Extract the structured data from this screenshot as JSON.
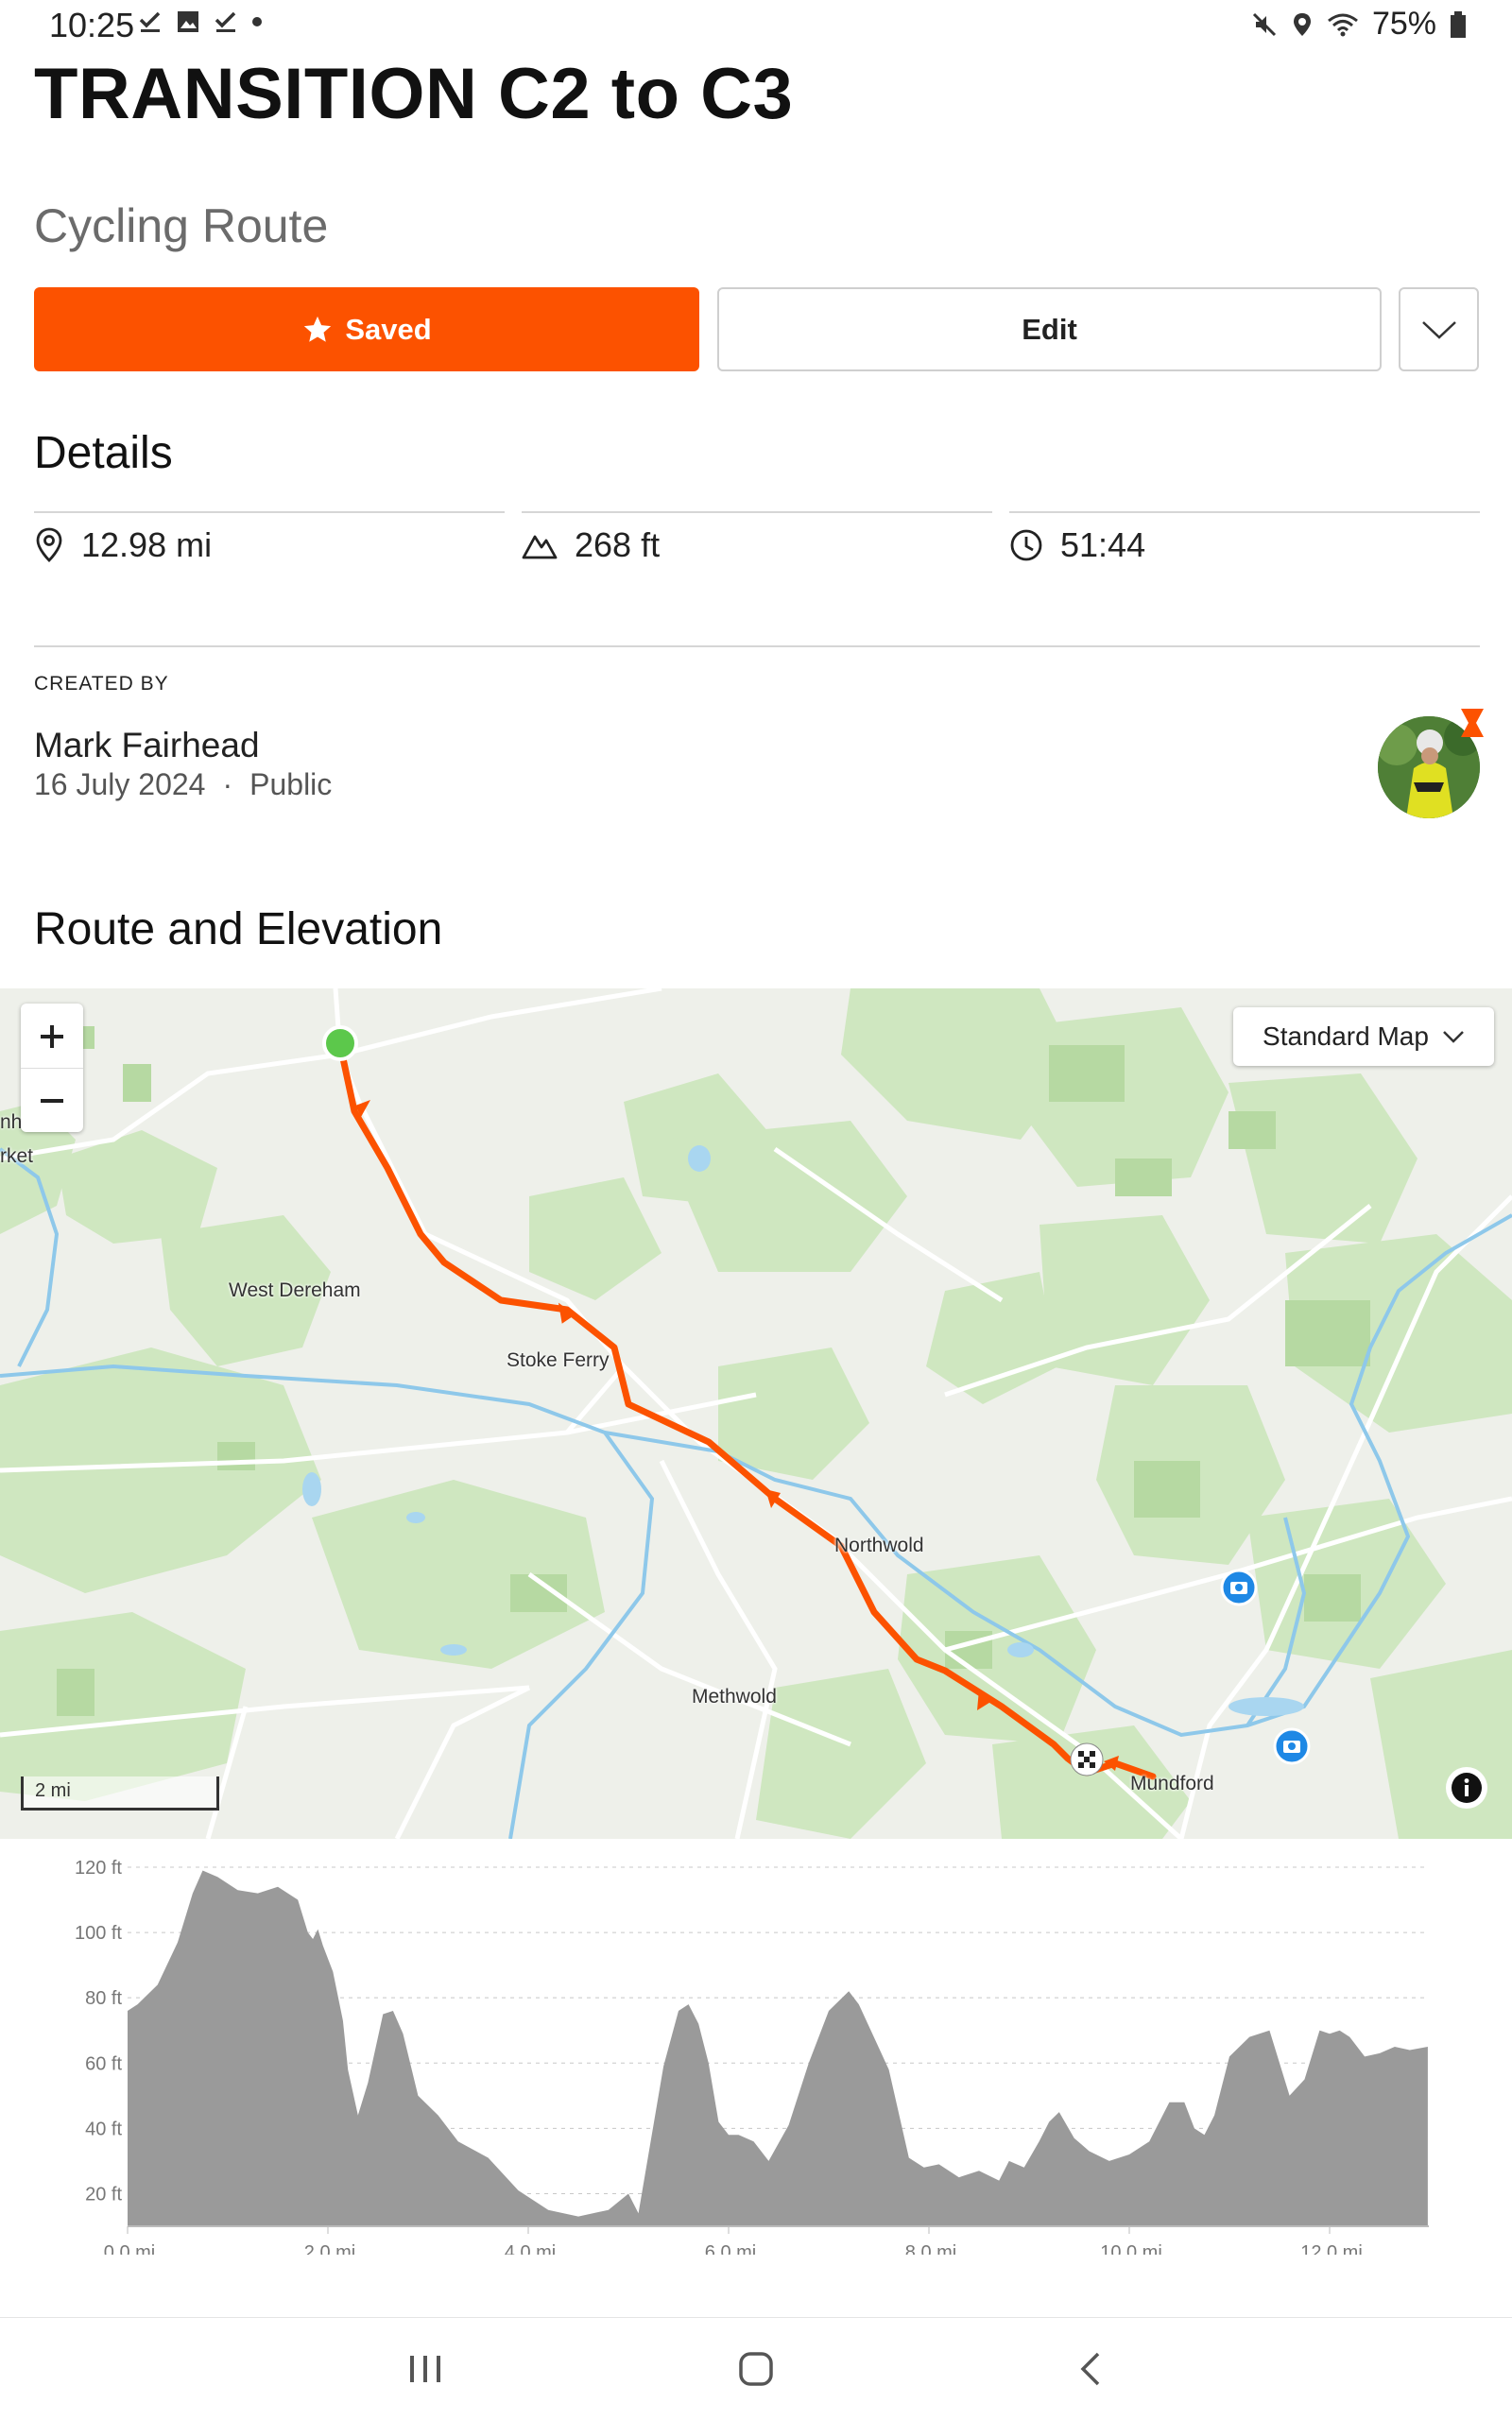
{
  "status_bar": {
    "time": "10:25",
    "battery": "75%"
  },
  "route": {
    "title": "TRANSITION C2 to C3",
    "type": "Cycling Route",
    "saved_label": "Saved",
    "edit_label": "Edit"
  },
  "details": {
    "heading": "Details",
    "distance": "12.98 mi",
    "elevation_gain": "268 ft",
    "est_time": "51:44"
  },
  "creator": {
    "label": "CREATED BY",
    "name": "Mark Fairhead",
    "date": "16 July 2024",
    "separator": "·",
    "visibility": "Public"
  },
  "map_section": {
    "heading": "Route and Elevation",
    "map_type": "Standard Map",
    "scale": "2 mi",
    "places": [
      "nham",
      "rket",
      "West Dereham",
      "Stoke Ferry",
      "Northwold",
      "Methwold",
      "Mundford"
    ]
  },
  "colors": {
    "accent": "#fc5200",
    "start": "#5cc84b",
    "elevation_fill": "#9a9a9a"
  },
  "chart_data": {
    "type": "area",
    "x_ticks": [
      "0.0 mi",
      "2.0 mi",
      "4.0 mi",
      "6.0 mi",
      "8.0 mi",
      "10.0 mi",
      "12.0 mi"
    ],
    "y_ticks": [
      "20 ft",
      "40 ft",
      "60 ft",
      "80 ft",
      "100 ft",
      "120 ft"
    ],
    "xlim": [
      0,
      12.98
    ],
    "ylim": [
      10,
      120
    ],
    "x": [
      0,
      0.1,
      0.3,
      0.5,
      0.65,
      0.75,
      0.9,
      1.1,
      1.3,
      1.5,
      1.7,
      1.8,
      1.85,
      1.9,
      1.95,
      2.05,
      2.15,
      2.2,
      2.3,
      2.4,
      2.55,
      2.65,
      2.75,
      2.9,
      3.1,
      3.3,
      3.6,
      3.9,
      4.2,
      4.5,
      4.8,
      5.0,
      5.1,
      5.2,
      5.35,
      5.5,
      5.6,
      5.7,
      5.8,
      5.9,
      6.0,
      6.1,
      6.25,
      6.4,
      6.6,
      6.8,
      7.0,
      7.2,
      7.3,
      7.45,
      7.6,
      7.8,
      7.95,
      8.1,
      8.3,
      8.5,
      8.7,
      8.8,
      8.95,
      9.1,
      9.2,
      9.3,
      9.45,
      9.6,
      9.8,
      10.0,
      10.2,
      10.4,
      10.55,
      10.65,
      10.75,
      10.85,
      11.0,
      11.2,
      11.4,
      11.6,
      11.75,
      11.9,
      12.0,
      12.1,
      12.2,
      12.35,
      12.5,
      12.65,
      12.8,
      12.98
    ],
    "values": [
      76,
      78,
      84,
      97,
      112,
      119,
      117,
      113,
      112,
      114,
      110,
      100,
      98,
      101,
      96,
      88,
      73,
      58,
      44,
      54,
      75,
      76,
      69,
      50,
      44,
      36,
      31,
      21,
      15,
      13,
      15,
      20,
      14,
      32,
      59,
      76,
      78,
      72,
      60,
      42,
      38,
      38,
      36,
      30,
      41,
      60,
      76,
      82,
      78,
      68,
      58,
      31,
      28,
      29,
      25,
      27,
      24,
      30,
      28,
      36,
      42,
      45,
      37,
      33,
      30,
      32,
      36,
      48,
      48,
      40,
      38,
      44,
      62,
      68,
      70,
      50,
      55,
      70,
      69,
      70,
      68,
      62,
      63,
      65,
      64,
      65
    ]
  }
}
